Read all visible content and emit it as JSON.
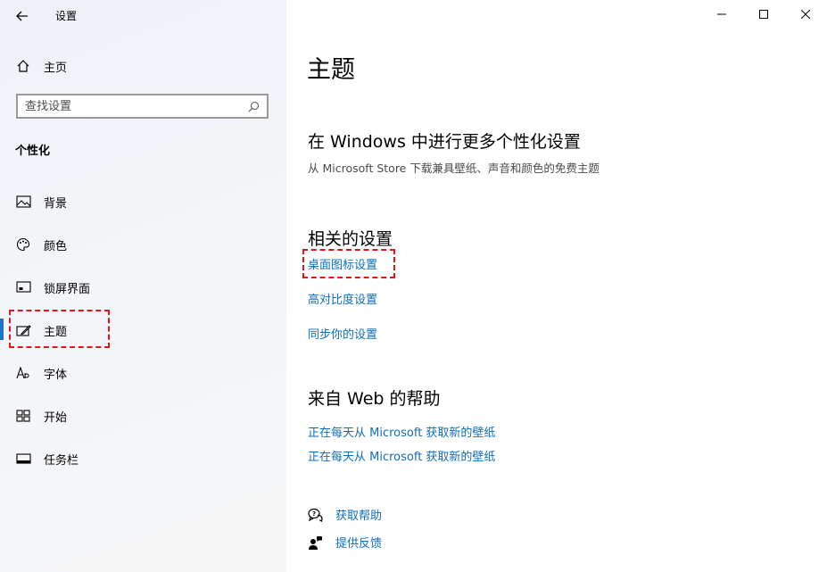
{
  "window": {
    "title": "设置",
    "controls": {
      "minimize_icon": "minimize-icon",
      "maximize_icon": "maximize-icon",
      "close_icon": "close-icon"
    }
  },
  "sidebar": {
    "home_label": "主页",
    "search": {
      "placeholder": "查找设置",
      "value": ""
    },
    "section_title": "个性化",
    "items": [
      {
        "label": "背景",
        "icon": "picture-icon"
      },
      {
        "label": "颜色",
        "icon": "palette-icon"
      },
      {
        "label": "锁屏界面",
        "icon": "lock-screen-icon"
      },
      {
        "label": "主题",
        "icon": "theme-brush-icon",
        "active": true
      },
      {
        "label": "字体",
        "icon": "font-icon"
      },
      {
        "label": "开始",
        "icon": "start-icon"
      },
      {
        "label": "任务栏",
        "icon": "taskbar-icon"
      }
    ]
  },
  "main": {
    "title": "主题",
    "more_personalize": {
      "heading": "在 Windows 中进行更多个性化设置",
      "description": "从 Microsoft Store 下载兼具壁纸、声音和颜色的免费主题"
    },
    "related": {
      "heading": "相关的设置",
      "links": [
        "桌面图标设置",
        "高对比度设置",
        "同步你的设置"
      ]
    },
    "web_help": {
      "heading": "来自 Web 的帮助",
      "links": [
        "正在每天从 Microsoft 获取新的壁纸",
        "正在每天从 Microsoft 获取新的壁纸"
      ]
    },
    "help": {
      "get_help": "获取帮助",
      "feedback": "提供反馈"
    }
  },
  "colors": {
    "accent": "#0f6cbd",
    "highlight": "#e0161d",
    "active_bar": "#1a73c7"
  }
}
